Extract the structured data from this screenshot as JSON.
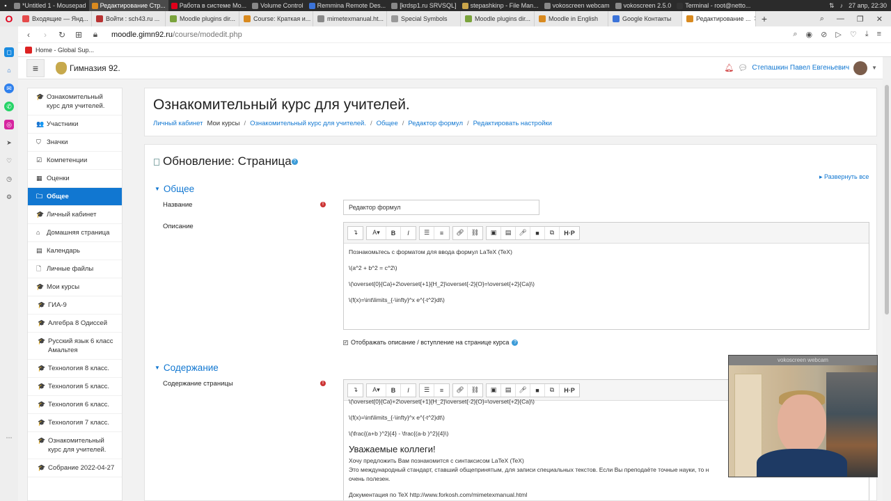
{
  "taskbar": {
    "tasks": [
      "*Untitled 1 - Mousepad",
      "Редактирование Стр...",
      "Работа в системе Мо...",
      "Volume Control",
      "Remmina Remote Des...",
      "[krdsp1.ru SRVSQL]",
      "stepashkinp - File Man...",
      "vokoscreen webcam",
      "vokoscreen 2.5.0",
      "Terminal - root@netto..."
    ],
    "datetime": "27 апр, 22:30"
  },
  "browser": {
    "tabs": [
      {
        "label": "Входящие — Янд...",
        "color": "#e54b4b"
      },
      {
        "label": "Войти : sch43.ru ...",
        "color": "#b83232"
      },
      {
        "label": "Moodle plugins dir...",
        "color": "#7aa33c"
      },
      {
        "label": "Course: Краткая и...",
        "color": "#d98a1f"
      },
      {
        "label": "mimetexmanual.ht...",
        "color": "#888888"
      },
      {
        "label": "Special Symbols",
        "color": "#999999"
      },
      {
        "label": "Moodle plugins dir...",
        "color": "#7aa33c"
      },
      {
        "label": "Moodle in English",
        "color": "#d98a1f"
      },
      {
        "label": "Google Контакты",
        "color": "#3b73d9"
      },
      {
        "label": "Редактирование ...",
        "color": "#d98a1f"
      }
    ],
    "url_domain": "moodle.gimn92.ru",
    "url_path": "/course/modedit.php",
    "bookmark": "Home - Global Sup..."
  },
  "moodle": {
    "site_name": "Гимназия 92.",
    "user_name": "Степашкин Павел Евгеньевич",
    "drawer": [
      {
        "icon": "🎓",
        "label": "Ознакомительный курс для учителей.",
        "active": false,
        "sub": false
      },
      {
        "icon": "👥",
        "label": "Участники",
        "active": false,
        "sub": false
      },
      {
        "icon": "⛉",
        "label": "Значки",
        "active": false,
        "sub": false
      },
      {
        "icon": "☑",
        "label": "Компетенции",
        "active": false,
        "sub": false
      },
      {
        "icon": "▦",
        "label": "Оценки",
        "active": false,
        "sub": false
      },
      {
        "icon": "🗀",
        "label": "Общее",
        "active": true,
        "sub": false
      },
      {
        "icon": "🎓",
        "label": "Личный кабинет",
        "active": false,
        "sub": false
      },
      {
        "icon": "⌂",
        "label": "Домашняя страница",
        "active": false,
        "sub": false
      },
      {
        "icon": "▤",
        "label": "Календарь",
        "active": false,
        "sub": false
      },
      {
        "icon": "🗋",
        "label": "Личные файлы",
        "active": false,
        "sub": false
      },
      {
        "icon": "🎓",
        "label": "Мои курсы",
        "active": false,
        "sub": false
      },
      {
        "icon": "🎓",
        "label": "ГИА-9",
        "active": false,
        "sub": true
      },
      {
        "icon": "🎓",
        "label": "Алгебра 8 Одиссей",
        "active": false,
        "sub": true
      },
      {
        "icon": "🎓",
        "label": "Русский язык 6 класс Амальтея",
        "active": false,
        "sub": true
      },
      {
        "icon": "🎓",
        "label": "Технология 8 класс.",
        "active": false,
        "sub": true
      },
      {
        "icon": "🎓",
        "label": "Технология 5 класс.",
        "active": false,
        "sub": true
      },
      {
        "icon": "🎓",
        "label": "Технология 6 класс.",
        "active": false,
        "sub": true
      },
      {
        "icon": "🎓",
        "label": "Технология 7 класс.",
        "active": false,
        "sub": true
      },
      {
        "icon": "🎓",
        "label": "Ознакомительный курс для учителей.",
        "active": false,
        "sub": true
      },
      {
        "icon": "🎓",
        "label": "Собрание 2022-04-27",
        "active": false,
        "sub": true
      }
    ],
    "course_title": "Ознакомительный курс для учителей.",
    "breadcrumb": {
      "dashboard": "Личный кабинет",
      "my_courses": "Мои курсы",
      "course": "Ознакомительный курс для учителей.",
      "section": "Общее",
      "module": "Редактор формул",
      "current": "Редактировать настройки"
    },
    "form": {
      "heading": "Обновление: Страница",
      "expand_all": "Развернуть все",
      "section_general": "Общее",
      "name_label": "Название",
      "name_value": "Редактор формул",
      "description_label": "Описание",
      "description_lines": [
        "Познакомьтесь с форматом для ввода формул LaTeX (TeX)",
        "\\(a^2 + b^2 = c^2\\)",
        "\\(\\overset{0}{Ca}+2\\overset{+1}{H_2}\\overset{-2}{O}=\\overset{+2}{Ca}\\)",
        "\\(f(x)=\\int\\limits_{-\\infty}^x e^{-t^2}dt\\)"
      ],
      "display_desc_label": "Отображать описание / вступление на странице курса",
      "section_content": "Содержание",
      "content_label": "Содержание страницы",
      "content_lines": [
        "\\(\\overset{0}{Ca}+2\\overset{+1}{H_2}\\overset{-2}{O}=\\overset{+2}{Ca}\\)",
        "\\(f(x)=\\int\\limits_{-\\infty}^x e^{-t^2}dt\\)",
        "\\(\\frac{(a+b )^2}{4} - \\frac{(a-b )^2}{4}\\)"
      ],
      "content_heading": "Уважаемые коллеги!",
      "content_para1": "Хочу предложить Вам познакомится с синтаксисом LaTeX (TeX)",
      "content_para2": "Это международный стандарт, ставший общепринятым, для записи специальных текстов. Если Вы преподаёте точные науки, то н",
      "content_para3": "очень полезен.",
      "content_para4": "Документация по TeX http://www.forkosh.com/mimetexmanual.html"
    }
  },
  "webcam": {
    "title": "vokoscreen webcam"
  }
}
